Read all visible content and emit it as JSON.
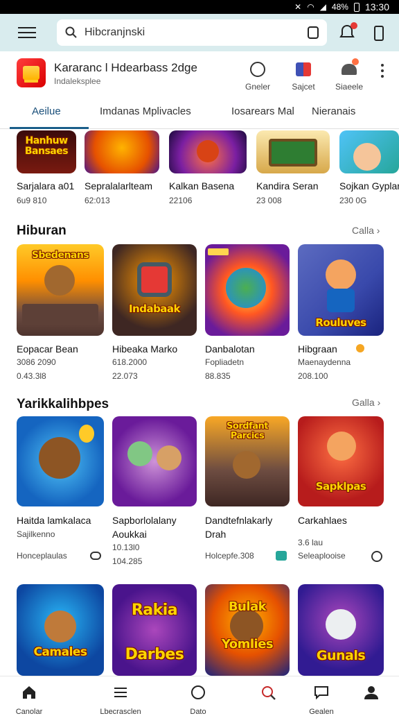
{
  "status_bar": {
    "time": "13:30",
    "battery": "48%"
  },
  "search": {
    "placeholder": "Hibcranjnski"
  },
  "app": {
    "title": "Kararanc l Hdearbass 2dge",
    "subtitle": "Indaleksplee"
  },
  "actions": [
    {
      "label": "Gneler",
      "icon": "circle-icon"
    },
    {
      "label": "Sajcet",
      "icon": "gift-icon"
    },
    {
      "label": "Siaeele",
      "icon": "hat-icon"
    }
  ],
  "tabs": [
    "Aeilue",
    "Imdanas Mplivacles",
    "Iosarears Mal",
    "Nieranais"
  ],
  "row1": [
    {
      "title": "Sarjalara a01",
      "meta": "6u9 810",
      "banner": "Hanhuw Bansaes"
    },
    {
      "title": "Sepralalarlteam",
      "meta": "62:013"
    },
    {
      "title": "Kalkan Basena",
      "meta": "22106"
    },
    {
      "title": "Kandira Seran",
      "meta": "23 008"
    },
    {
      "title": "Sojkan Gyplar",
      "meta": "230 0G"
    }
  ],
  "section1": {
    "title": "Hiburan",
    "more": "Calla",
    "items": [
      {
        "title": "Eopacar Bean",
        "line1": "3086 2090",
        "line2": "0.43.3l8",
        "banner": "Sbedenans"
      },
      {
        "title": "Hibeaka Marko",
        "line1": "618.2000",
        "line2": "22.073",
        "banner": "Indabaak"
      },
      {
        "title": "Danbalotan",
        "line1": "Fopliadetn",
        "line2": "88.835",
        "banner": ""
      },
      {
        "title": "Hibgraan",
        "line1": "Maenaydenna",
        "line2": "208.100",
        "banner": "Rouluves"
      }
    ]
  },
  "section2": {
    "title": "Yarikkalihbpes",
    "more": "Galla",
    "items": [
      {
        "title": "Haitda lamkalaca",
        "line1": "Sajilkenno",
        "line2": "Honceplaulas",
        "line3": ""
      },
      {
        "title": "Sapborlolalany",
        "line1": "Aoukkai",
        "line2": "10.13l0",
        "line3": "104.285"
      },
      {
        "title": "Dandtefnlakarly",
        "line1": "Drah",
        "line2": "Holcepfe.308",
        "line3": "",
        "banner": "Sordfant Parcics"
      },
      {
        "title": "Carkahlaes",
        "line1": "3.6 lau",
        "line2": "Seleaplooise",
        "line3": "",
        "banner": "Sapklpas"
      }
    ]
  },
  "row4": [
    {
      "banner": "Camales"
    },
    {
      "banner": "Rakia Darbes"
    },
    {
      "banner": "Bulak Yomlies"
    },
    {
      "banner": "Gunals"
    }
  ],
  "bottom_nav": [
    "Canolar",
    "Lbecrasclen",
    "Dato",
    "",
    "Gealen",
    ""
  ],
  "colors": {
    "accent": "#1a5e8a",
    "topbar": "#d9ecee"
  }
}
